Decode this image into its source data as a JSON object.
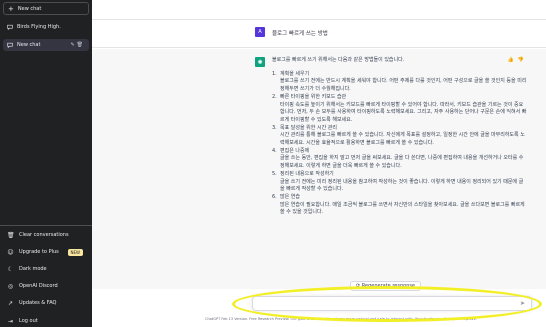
{
  "sidebar": {
    "new_chat": "New chat",
    "conversations": [
      {
        "label": "Birds Flying High.",
        "active": false
      },
      {
        "label": "New chat",
        "active": true
      }
    ],
    "bottom": {
      "clear": "Clear conversations",
      "upgrade": "Upgrade to Plus",
      "upgrade_badge": "NEW",
      "dark_mode": "Dark mode",
      "discord": "OpenAI Discord",
      "faq": "Updates & FAQ",
      "logout": "Log out"
    }
  },
  "user_message": {
    "avatar_letter": "A",
    "text": "블로그 빠르게 쓰는 방법"
  },
  "assistant": {
    "intro": "블로그를 빠르게 쓰기 위해서는 다음과 같은 방법들이 있습니다.",
    "items": [
      {
        "n": "1.",
        "title": "계획을 세우기",
        "desc": "블로그를 쓰기 전에는 반드시 계획을 세워야 합니다. 어떤 주제를 다룰 것인지, 어떤 구성으로 글을 쓸 것인지 등을 미리 정해두면 쓰기가 더 수월해집니다."
      },
      {
        "n": "2.",
        "title": "빠른 타이핑을 위한 키보드 습관",
        "desc": "타이핑 속도를 높이기 위해서는 키보드를 빠르게 타이핑할 수 있어야 합니다. 따라서, 키보드 습관을 기르는 것이 중요합니다. 먼저, 두 손 모두를 사용하여 타이핑하도록 노력해보세요. 그리고, 자주 사용하는 단어나 구문은 손에 익혀서 빠르게 타이핑할 수 있도록 해보세요."
      },
      {
        "n": "3.",
        "title": "목표 달성을 위한 시간 관리",
        "desc": "시간 관리를 통해 블로그를 빠르게 쓸 수 있습니다. 자신에게 목표를 설정하고, 일정한 시간 안에 글을 마무리하도록 노력해보세요. 시간을 효율적으로 활용하면 블로그를 빠르게 쓸 수 있습니다."
      },
      {
        "n": "4.",
        "title": "편집은 나중에",
        "desc": "글을 쓰는 동안, 편집을 하지 말고 먼저 글을 써보세요. 글을 다 쓴다면, 나중에 편집하여 내용을 개선하거나 오타를 수정해보세요. 이렇게 하면 글을 더욱 빠르게 쓸 수 있습니다."
      },
      {
        "n": "5.",
        "title": "정리된 내용으로 작성하기",
        "desc": "글을 쓰기 전에는 미리 정리된 내용을 참고하여 작성하는 것이 좋습니다. 이렇게 하면 내용이 정리되어 있기 때문에 글을 빠르게 작성할 수 있습니다."
      },
      {
        "n": "6.",
        "title": "많은 연습",
        "desc": "많은 연습이 필요합니다. 매일 조금씩 블로그를 쓰면서 자신만의 스타일을 찾아보세요. 글을 쓰다보면 블로그를 빠르게 쓸 수 있을 것입니다."
      }
    ]
  },
  "regenerate": "⟳ Regenerate response",
  "footer": "ChatGPT Feb 13 Version. Free Research Preview. Our goal is to make AI systems more natural and safe to interact with. Your feedback will help us improve.",
  "colors": {
    "sidebar_bg": "#202123",
    "assistant_bg": "#f7f7f8",
    "avatar_user": "#5436da",
    "avatar_assistant": "#10a37f",
    "highlight": "#f2ef27"
  }
}
